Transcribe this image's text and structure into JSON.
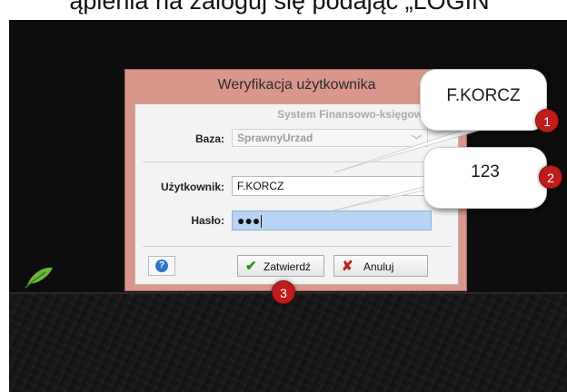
{
  "caption": {
    "text": "ąpienia na zaloguj się podając „LOGIN”"
  },
  "dialog": {
    "title": "Weryfikacja użytkownika",
    "system_label": "System Finansowo-księgowy w...",
    "baza": {
      "label": "Baza:",
      "value": "SprawnyUrzad"
    },
    "user": {
      "label": "Użytkownik:",
      "value": "F.KORCZ"
    },
    "password": {
      "label": "Hasło:",
      "masked": "●●●"
    },
    "buttons": {
      "help": "?",
      "confirm": "Zatwierdź",
      "cancel": "Anuluj"
    }
  },
  "annotations": [
    {
      "number": "1",
      "text": "F.KORCZ"
    },
    {
      "number": "2",
      "text": "123"
    },
    {
      "number": "3"
    }
  ],
  "colors": {
    "dialog_frame": "#d9968b",
    "badge": "#c01c1c",
    "selection": "#b9d4f3"
  },
  "icons": {
    "help": "help-icon",
    "confirm": "check-icon",
    "cancel": "x-icon"
  }
}
